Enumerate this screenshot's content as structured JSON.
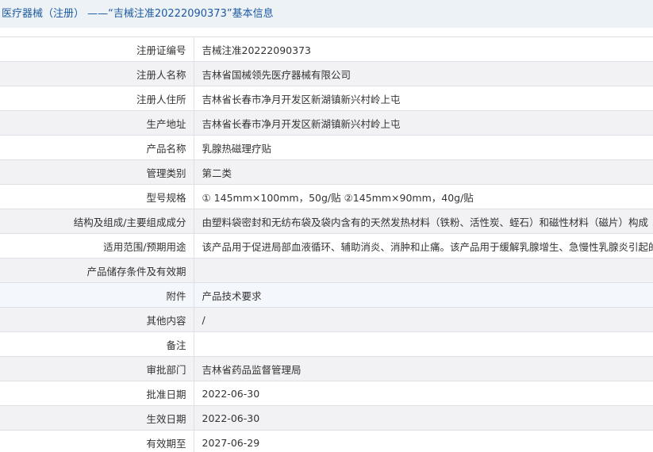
{
  "header": {
    "title": "医疗器械（注册） ——“吉械注准20222090373”基本信息"
  },
  "rows": [
    {
      "label": "注册证编号",
      "value": "吉械注准20222090373"
    },
    {
      "label": "注册人名称",
      "value": "吉林省国械领先医疗器械有限公司"
    },
    {
      "label": "注册人住所",
      "value": "吉林省长春市净月开发区新湖镇新兴村岭上屯"
    },
    {
      "label": "生产地址",
      "value": "吉林省长春市净月开发区新湖镇新兴村岭上屯"
    },
    {
      "label": "产品名称",
      "value": "乳腺热磁理疗贴"
    },
    {
      "label": "管理类别",
      "value": "第二类"
    },
    {
      "label": "型号规格",
      "value": "① 145mm×100mm，50g/贴 ②145mm×90mm，40g/贴"
    },
    {
      "label": "结构及组成/主要组成成分",
      "value": "由塑料袋密封和无纺布袋及袋内含有的天然发热材料（铁粉、活性炭、蛭石）和磁性材料（磁片）构成"
    },
    {
      "label": "适用范围/预期用途",
      "value": "该产品用于促进局部血液循环、辅助消炎、消肿和止痛。该产品用于缓解乳腺增生、急慢性乳腺炎引起的"
    },
    {
      "label": "产品储存条件及有效期",
      "value": ""
    },
    {
      "label": "附件",
      "value": "产品技术要求"
    },
    {
      "label": "其他内容",
      "value": "/"
    },
    {
      "label": "备注",
      "value": ""
    },
    {
      "label": "审批部门",
      "value": "吉林省药品监督管理局"
    },
    {
      "label": "批准日期",
      "value": "2022-06-30"
    },
    {
      "label": "生效日期",
      "value": "2022-06-30"
    },
    {
      "label": "有效期至",
      "value": "2027-06-29"
    }
  ]
}
